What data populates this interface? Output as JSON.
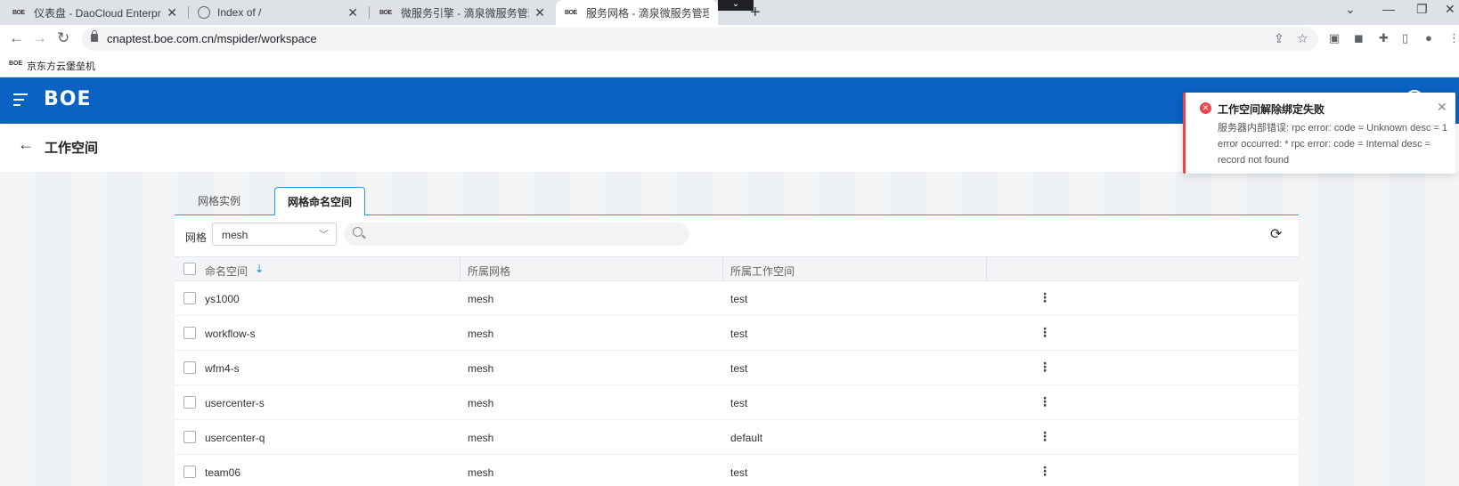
{
  "browser": {
    "tabs": [
      {
        "favicon": "BOE",
        "title": "仪表盘 - DaoCloud Enterprise"
      },
      {
        "favicon": "globe-icon",
        "title": "Index of /"
      },
      {
        "favicon": "BOE",
        "title": "微服务引擎 - 滴泉微服务管理平台"
      },
      {
        "favicon": "BOE",
        "title": "服务网格 - 滴泉微服务管理平台"
      }
    ],
    "url": "cnaptest.boe.com.cn/mspider/workspace",
    "bookmark": {
      "favicon": "BOE",
      "label": "京东方云堡垒机"
    }
  },
  "app": {
    "logo": "BOE",
    "page_title": "工作空间"
  },
  "panel_tabs": [
    "网格实例",
    "网格命名空间"
  ],
  "filter": {
    "label": "网格",
    "selected_mesh": "mesh"
  },
  "table": {
    "columns": [
      "命名空间",
      "所属网格",
      "所属工作空间"
    ],
    "rows": [
      {
        "namespace": "ys1000",
        "mesh": "mesh",
        "workspace": "test"
      },
      {
        "namespace": "workflow-s",
        "mesh": "mesh",
        "workspace": "test"
      },
      {
        "namespace": "wfm4-s",
        "mesh": "mesh",
        "workspace": "test"
      },
      {
        "namespace": "usercenter-s",
        "mesh": "mesh",
        "workspace": "test"
      },
      {
        "namespace": "usercenter-q",
        "mesh": "mesh",
        "workspace": "default"
      },
      {
        "namespace": "team06",
        "mesh": "mesh",
        "workspace": "test"
      }
    ]
  },
  "toast": {
    "type": "error",
    "title": "工作空间解除绑定失败",
    "message": "服务器内部错误: rpc error: code = Unknown desc = 1 error occurred: * rpc error: code = Internal desc = record not found"
  },
  "colors": {
    "brand": "#0a62c2",
    "accent": "#1e9fd6",
    "error": "#e5484d"
  }
}
